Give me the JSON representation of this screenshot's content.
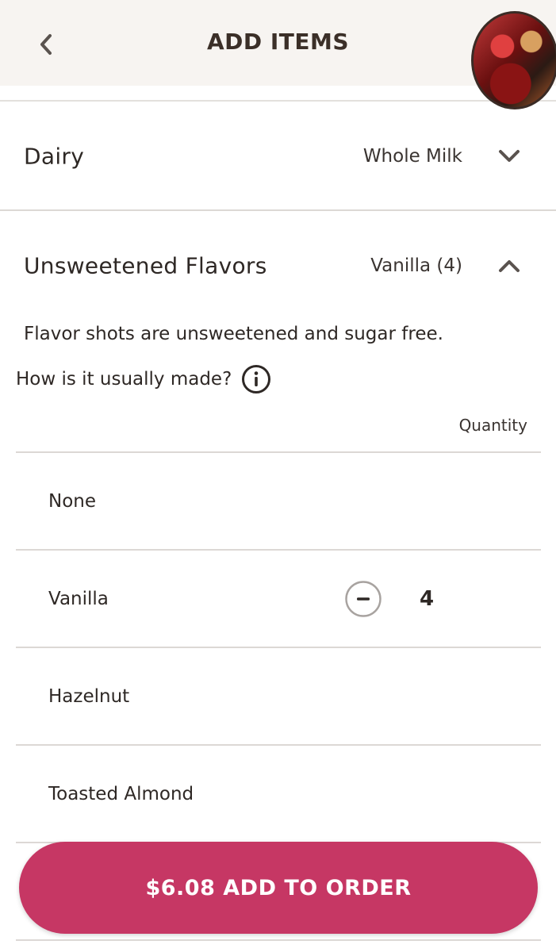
{
  "header": {
    "title": "ADD ITEMS",
    "back_icon": "chevron-left-icon",
    "avatar": "profile-avatar"
  },
  "sections": [
    {
      "title": "Dairy",
      "value": "Whole Milk",
      "expanded": false,
      "icon": "chevron-down-icon"
    },
    {
      "title": "Unsweetened Flavors",
      "value": "Vanilla (4)",
      "expanded": true,
      "icon": "chevron-up-icon"
    }
  ],
  "flavors": {
    "note": "Flavor shots are unsweetened and sugar free.",
    "how_made_label": "How is it usually made?",
    "info_icon": "info-icon",
    "quantity_header": "Quantity",
    "options": [
      {
        "label": "None",
        "quantity": null
      },
      {
        "label": "Vanilla",
        "quantity": "4"
      },
      {
        "label": "Hazelnut",
        "quantity": null
      },
      {
        "label": "Toasted Almond",
        "quantity": null
      }
    ]
  },
  "cta": {
    "label": "$6.08 ADD TO ORDER",
    "color": "#c63764"
  },
  "colors": {
    "header_bg": "#f7f4f1",
    "text": "#2e2825",
    "divider": "#dcd8d5"
  }
}
